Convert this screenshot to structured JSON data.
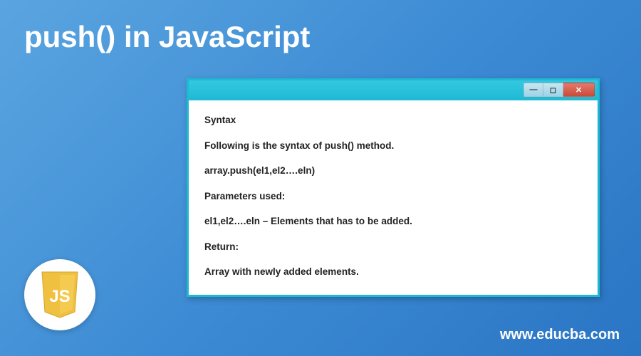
{
  "page": {
    "title": "push() in JavaScript",
    "site_url": "www.educba.com",
    "logo_label": "JS"
  },
  "window": {
    "controls": {
      "minimize": "—",
      "maximize": "◻",
      "close": "✕"
    },
    "body": {
      "heading": "Syntax",
      "intro": "Following is the syntax of push() method.",
      "code": "array.push(el1,el2….eln)",
      "params_label": "Parameters used:",
      "params_desc": "el1,el2….eln – Elements that has to be added.",
      "return_label": "Return:",
      "return_desc": "Array with newly added elements."
    }
  }
}
